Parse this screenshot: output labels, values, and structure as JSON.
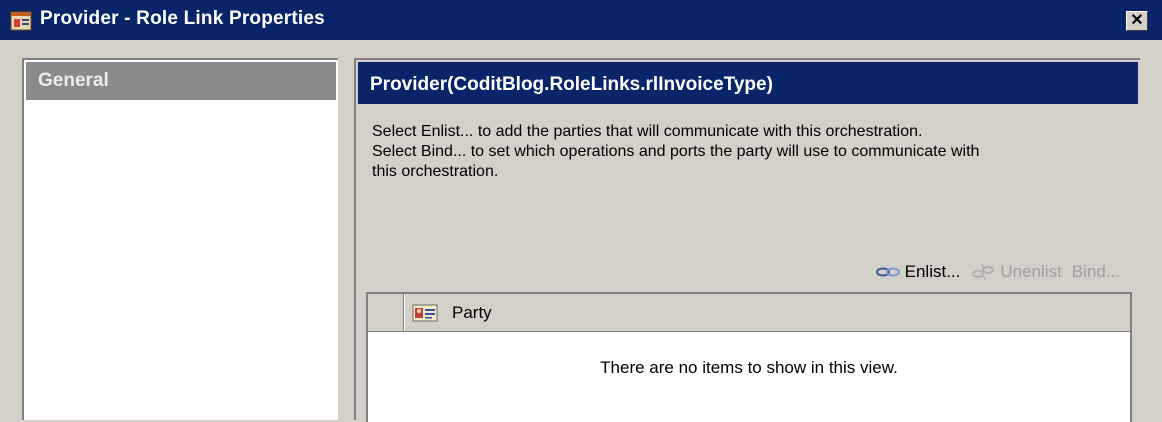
{
  "window": {
    "title": "Provider - Role Link Properties",
    "icon": "properties-window-icon",
    "close_label": "✕"
  },
  "sidebar": {
    "items": [
      {
        "label": "General"
      }
    ]
  },
  "panel": {
    "header": "Provider(CoditBlog.RoleLinks.rlInvoiceType)",
    "description": [
      "Select Enlist... to add the parties that will communicate with this orchestration.",
      "Select Bind... to set which operations and ports the party will use to communicate with",
      "this orchestration."
    ],
    "toolbar": {
      "enlist_label": "Enlist...",
      "unenlist_label": "Unenlist",
      "bind_label": "Bind..."
    },
    "list": {
      "column_header": "Party",
      "empty_message": "There are no items to show in this view."
    }
  },
  "colors": {
    "title_bar": "#0a246a",
    "dialog_face": "#d4d0c8",
    "sidebar_selected": "#8a8a8a",
    "disabled_text": "#a0a0a0"
  }
}
